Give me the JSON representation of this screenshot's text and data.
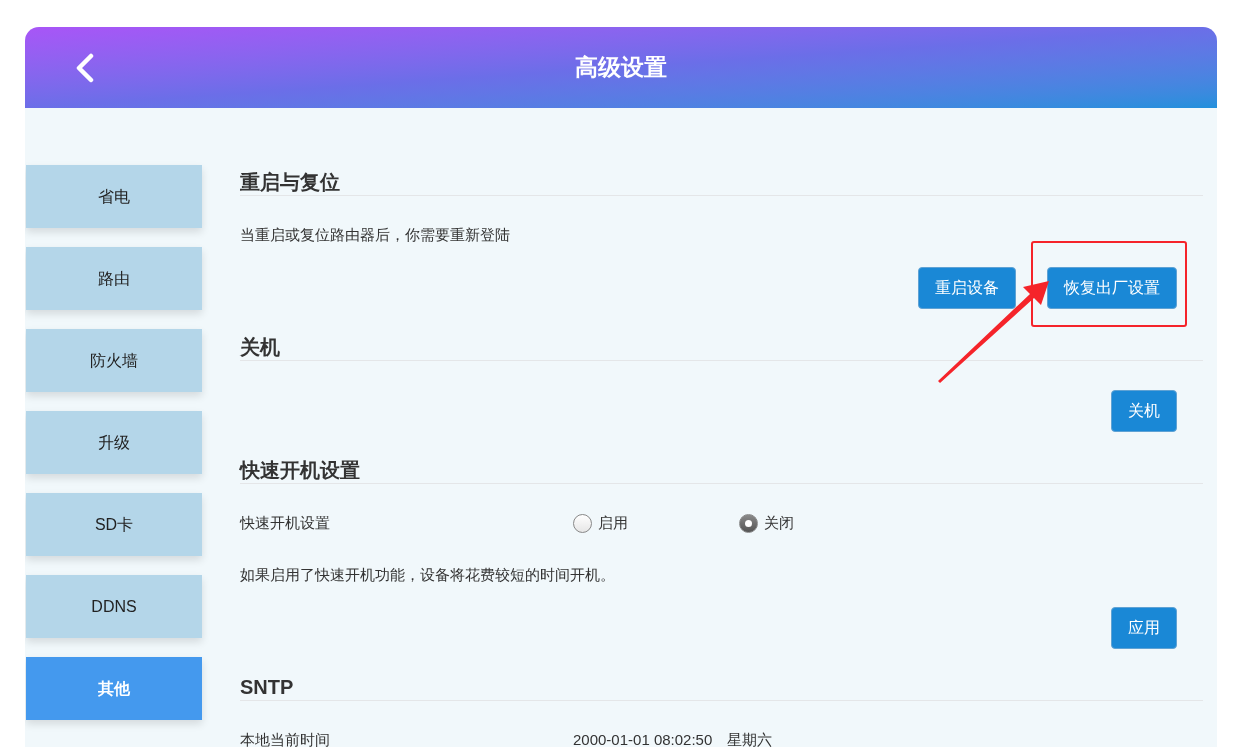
{
  "header": {
    "title": "高级设置"
  },
  "sidebar": {
    "items": [
      {
        "label": "省电",
        "selected": false
      },
      {
        "label": "路由",
        "selected": false
      },
      {
        "label": "防火墙",
        "selected": false
      },
      {
        "label": "升级",
        "selected": false
      },
      {
        "label": "SD卡",
        "selected": false
      },
      {
        "label": "DDNS",
        "selected": false
      },
      {
        "label": "其他",
        "selected": true
      }
    ]
  },
  "sections": [
    {
      "heading": "重启与复位",
      "blocks": [
        {
          "kind": "text",
          "text": "当重启或复位路由器后，你需要重新登陆"
        },
        {
          "kind": "buttons",
          "buttons": [
            {
              "label": "重启设备",
              "highlighted": false
            },
            {
              "label": "恢复出厂设置",
              "highlighted": true
            }
          ]
        }
      ]
    },
    {
      "heading": "关机",
      "blocks": [
        {
          "kind": "buttons",
          "buttons": [
            {
              "label": "关机",
              "highlighted": false
            }
          ]
        }
      ]
    },
    {
      "heading": "快速开机设置",
      "blocks": [
        {
          "kind": "radio",
          "label": "快速开机设置",
          "options": [
            {
              "label": "启用",
              "selected": false
            },
            {
              "label": "关闭",
              "selected": true
            }
          ]
        },
        {
          "kind": "text",
          "text": "如果启用了快速开机功能，设备将花费较短的时间开机。"
        },
        {
          "kind": "buttons",
          "buttons": [
            {
              "label": "应用",
              "highlighted": false
            }
          ]
        }
      ]
    },
    {
      "heading": "SNTP",
      "blocks": [
        {
          "kind": "field",
          "label": "本地当前时间",
          "value": "2000-01-01 08:02:50",
          "extra": "星期六"
        }
      ]
    }
  ]
}
